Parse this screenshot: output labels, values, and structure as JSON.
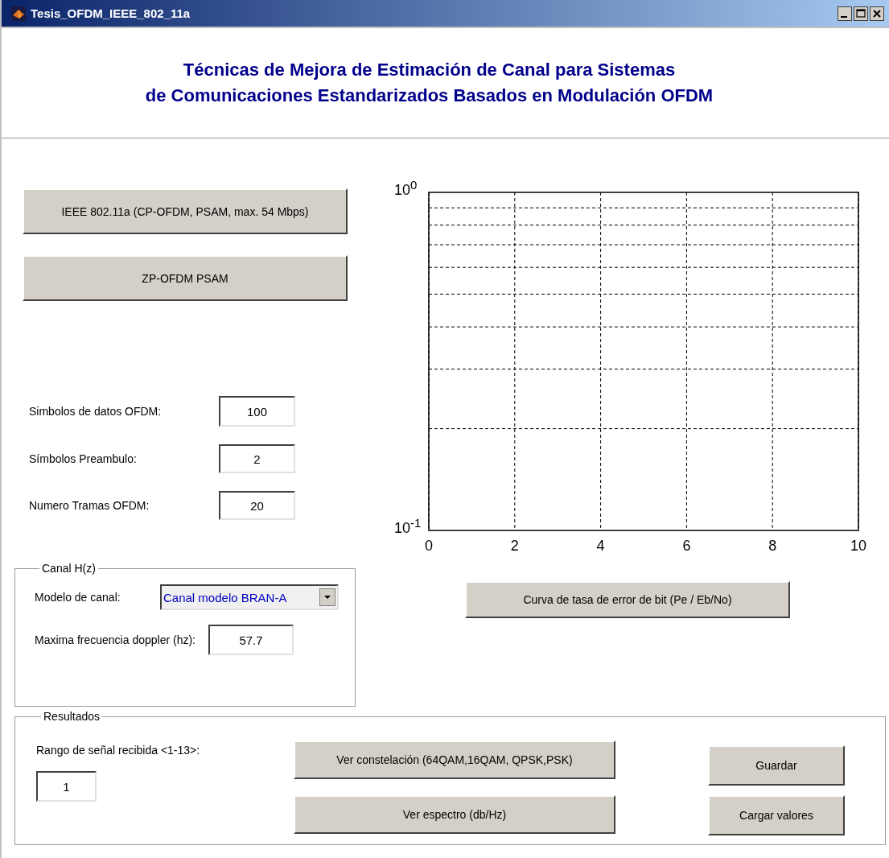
{
  "window": {
    "title": "Tesis_OFDM_IEEE_802_11a"
  },
  "header": {
    "lines": [
      "Técnicas de Mejora de Estimación de Canal para Sistemas",
      "de Comunicaciones Estandarizados Basados en Modulación OFDM"
    ]
  },
  "mode_buttons": [
    "IEEE 802.11a (CP-OFDM, PSAM, max. 54 Mbps)",
    "ZP-OFDM PSAM"
  ],
  "parameters": [
    {
      "label": "Simbolos de datos OFDM:",
      "value": "100"
    },
    {
      "label": "Símbolos Preambulo:",
      "value": "2"
    },
    {
      "label": "Numero Tramas OFDM:",
      "value": "20"
    }
  ],
  "channel": {
    "title": "Canal H(z)",
    "model_label": "Modelo de canal:",
    "model_value": "Canal modelo BRAN-A",
    "doppler_label": "Maxima frecuencia doppler (hz):",
    "doppler_value": "57.7"
  },
  "plot": {
    "chart_data": {
      "type": "line",
      "grid": true,
      "xlim": [
        0,
        10
      ],
      "ylim": [
        0.1,
        1
      ],
      "xticks": [
        {
          "value": 0,
          "label": "0"
        },
        {
          "value": 2,
          "label": "2"
        },
        {
          "value": 4,
          "label": "4"
        },
        {
          "value": 6,
          "label": "6"
        },
        {
          "value": 8,
          "label": "8"
        },
        {
          "value": 10,
          "label": "10"
        }
      ],
      "yticks": [
        {
          "value": 0.1,
          "label": "10$^{-1}$"
        },
        {
          "value": 1,
          "label": "10$^{0}$"
        }
      ]
    }
  },
  "ber_button": "Curva de tasa de error de bit (Pe / Eb/No)",
  "results": {
    "title": "Resultados",
    "range_label": "Rango de señal recibida <1-13>:",
    "range_value": "1",
    "view_buttons": [
      "Ver constelación (64QAM,16QAM, QPSK,PSK)",
      "Ver espectro (db/Hz)"
    ],
    "side_buttons": [
      "Guardar",
      "Cargar valores"
    ]
  }
}
